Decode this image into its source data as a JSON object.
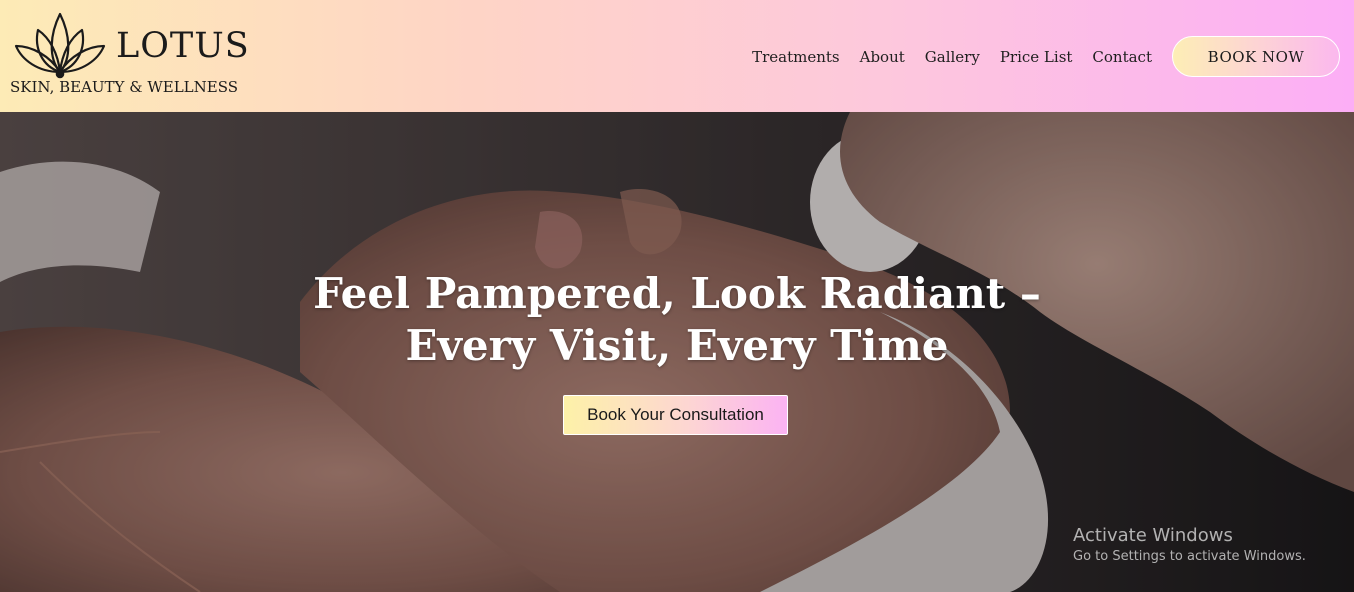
{
  "brand": {
    "name": "LOTUS",
    "tagline": "SKIN, BEAUTY & WELLNESS",
    "logo_icon": "lotus-icon"
  },
  "nav": {
    "items": [
      {
        "label": "Treatments"
      },
      {
        "label": "About"
      },
      {
        "label": "Gallery"
      },
      {
        "label": "Price List"
      },
      {
        "label": "Contact"
      }
    ],
    "cta_label": "BOOK NOW"
  },
  "hero": {
    "title_line1": "Feel Pampered, Look Radiant –",
    "title_line2": "Every Visit, Every Time",
    "button_label": "Book Your Consultation",
    "image_subject": "woman receiving a facial cleansing treatment with a cotton pad"
  },
  "watermark": {
    "title": "Activate Windows",
    "subtitle": "Go to Settings to activate Windows."
  },
  "colors": {
    "header_gradient_start": "#fdebb6",
    "header_gradient_end": "#fcaef6",
    "button_gradient_start": "#fdf1a8",
    "button_gradient_end": "#fbb3f3",
    "hero_text": "#ffffff"
  }
}
